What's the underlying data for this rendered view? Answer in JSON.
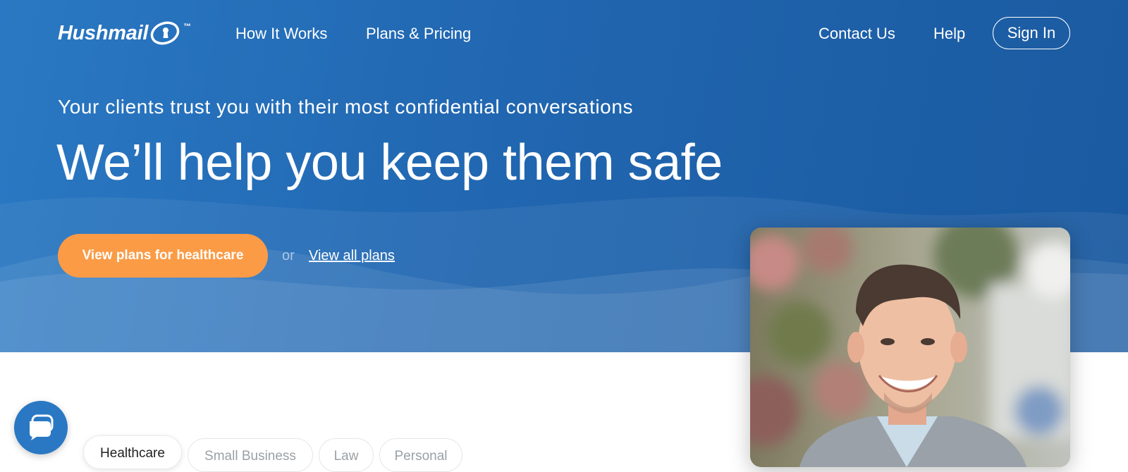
{
  "brand": {
    "name": "Hushmail",
    "trademark": "™"
  },
  "nav": {
    "how_it_works": "How It Works",
    "plans_pricing": "Plans & Pricing",
    "contact_us": "Contact Us",
    "help": "Help",
    "sign_in": "Sign In"
  },
  "hero": {
    "eyebrow": "Your clients trust you with their most confidential conversations",
    "headline": "We’ll help you keep them safe",
    "cta_label": "View plans for healthcare",
    "or_text": "or",
    "all_plans_link": "View all plans"
  },
  "tabs": [
    {
      "label": "Healthcare",
      "active": true
    },
    {
      "label": "Small Business",
      "active": false
    },
    {
      "label": "Law",
      "active": false
    },
    {
      "label": "Personal",
      "active": false
    }
  ],
  "colors": {
    "hero_blue": "#2166b0",
    "cta_orange": "#fb9b46",
    "chat_blue": "#2a78c3"
  },
  "icons": {
    "logo_mark": "keyhole-icon",
    "chat": "chat-bubble-icon"
  }
}
